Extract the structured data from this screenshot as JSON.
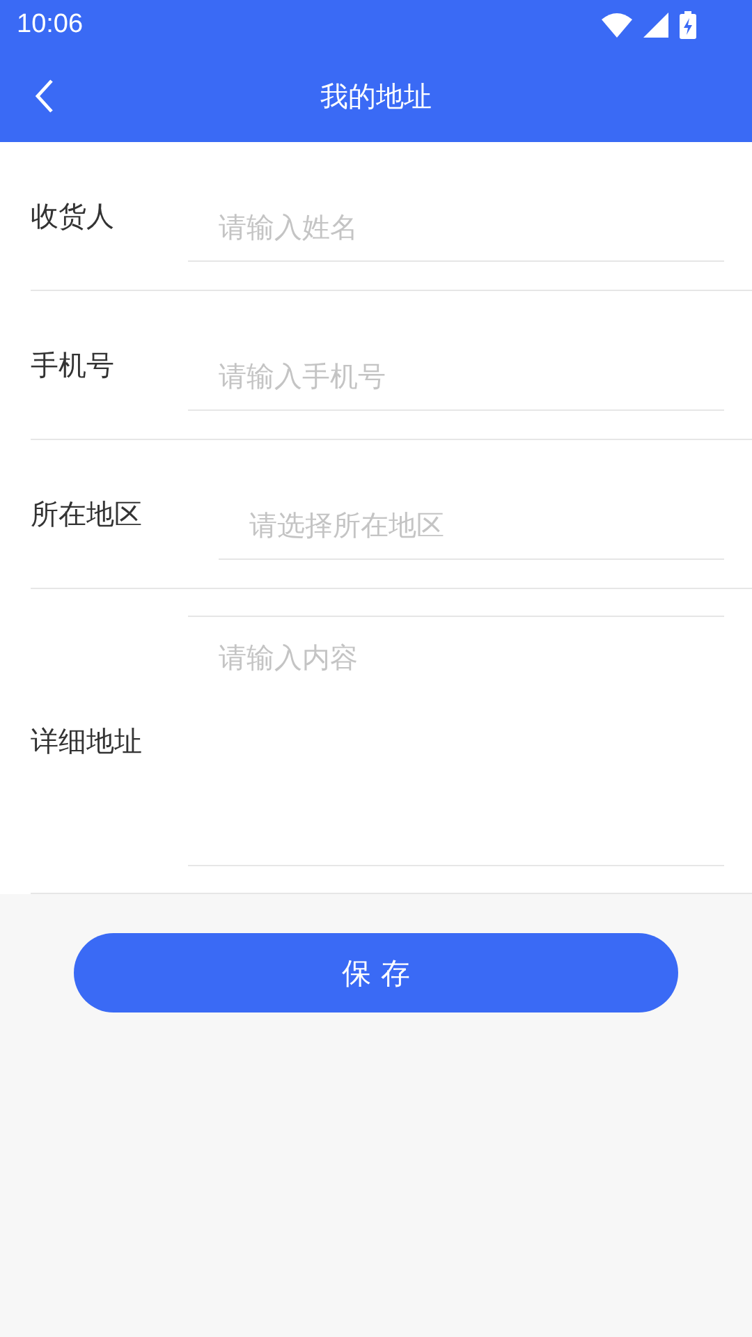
{
  "status_bar": {
    "time": "10:06"
  },
  "header": {
    "title": "我的地址"
  },
  "form": {
    "fields": [
      {
        "label": "收货人",
        "placeholder": "请输入姓名",
        "kind": "input"
      },
      {
        "label": "手机号",
        "placeholder": "请输入手机号",
        "kind": "input"
      },
      {
        "label": "所在地区",
        "placeholder": "请选择所在地区",
        "kind": "picker"
      },
      {
        "label": "详细地址",
        "placeholder": "请输入内容",
        "kind": "textarea"
      }
    ]
  },
  "save_button": {
    "label": "保 存"
  }
}
